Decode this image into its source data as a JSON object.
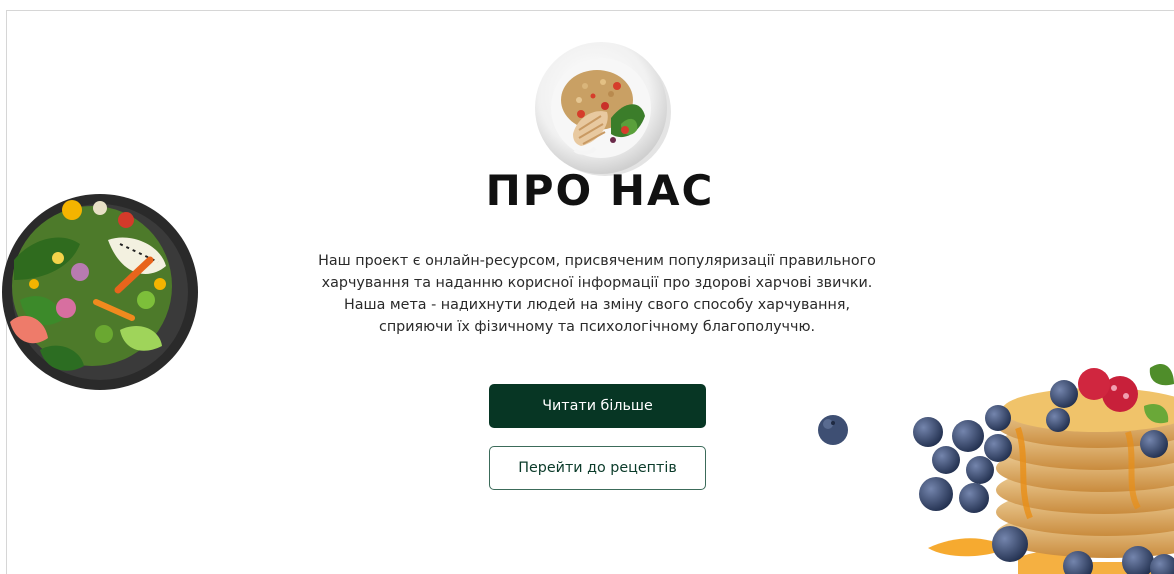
{
  "about": {
    "title": "ПРО НАС",
    "description_lines": [
      "Наш проект є онлайн-ресурсом, присвяченим популяризації правильного",
      "харчування та наданню корисної інформації про здорові харчові звички.",
      "Наша мета - надихнути людей на зміну свого способу харчування,",
      "сприяючи їх фізичному та психологічному благополуччю."
    ],
    "read_more_label": "Читати більше",
    "recipes_label": "Перейти до рецептів"
  },
  "images": {
    "top": "salad-plate-image",
    "left": "salad-bowl-image",
    "right": "pancakes-image",
    "float": "blueberry-image"
  },
  "colors": {
    "primary_button": "#073624",
    "secondary_border": "#3c6b5a",
    "text": "#2a2a2a",
    "title": "#111111"
  }
}
